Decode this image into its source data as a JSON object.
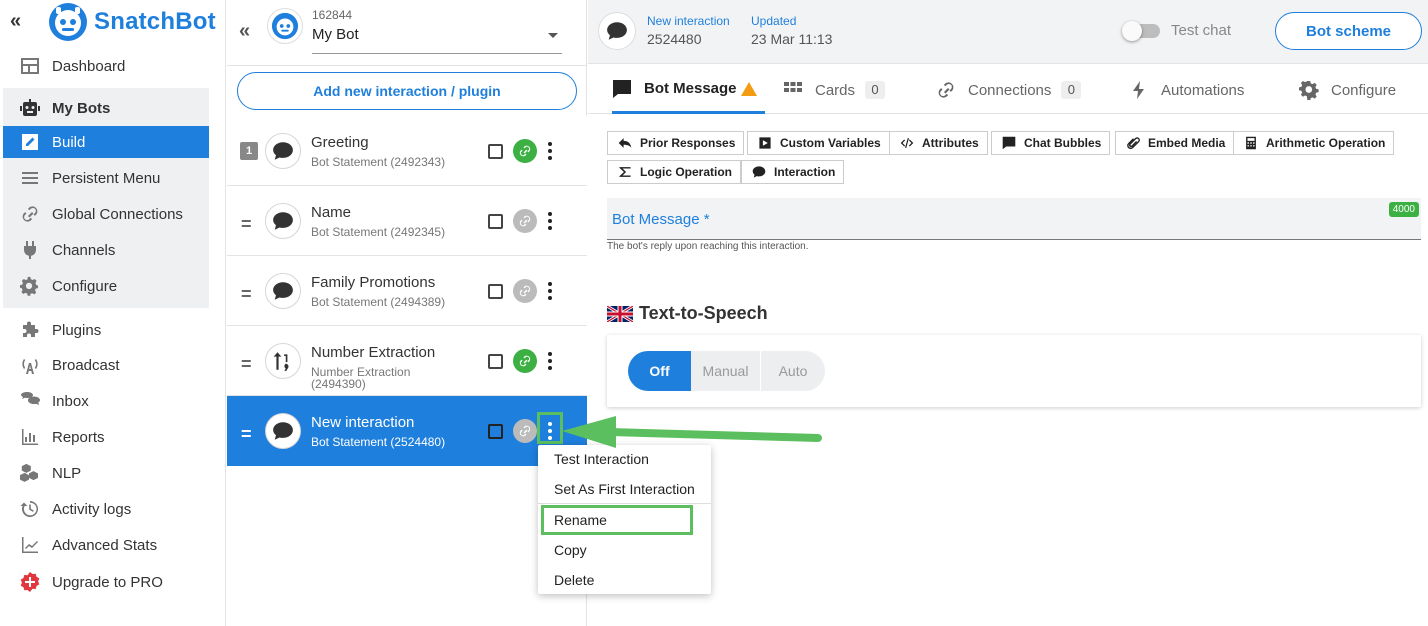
{
  "app": {
    "name": "SnatchBot",
    "brand_color": "#1e7fdc"
  },
  "sidebar": {
    "items": [
      {
        "label": "Dashboard",
        "icon": "dashboard-icon"
      },
      {
        "label": "My Bots",
        "icon": "robot-icon"
      },
      {
        "label": "Build",
        "icon": "edit-icon",
        "active": true
      },
      {
        "label": "Persistent Menu",
        "icon": "menu-icon"
      },
      {
        "label": "Global Connections",
        "icon": "link-icon"
      },
      {
        "label": "Channels",
        "icon": "plug-icon"
      },
      {
        "label": "Configure",
        "icon": "gear-icon"
      },
      {
        "label": "Plugins",
        "icon": "puzzle-icon"
      },
      {
        "label": "Broadcast",
        "icon": "broadcast-icon"
      },
      {
        "label": "Inbox",
        "icon": "chat-icon"
      },
      {
        "label": "Reports",
        "icon": "bar-chart-icon"
      },
      {
        "label": "NLP",
        "icon": "cubes-icon"
      },
      {
        "label": "Activity logs",
        "icon": "history-icon"
      },
      {
        "label": "Advanced Stats",
        "icon": "line-chart-icon"
      },
      {
        "label": "Upgrade to PRO",
        "icon": "plus-badge-icon"
      }
    ]
  },
  "bot": {
    "id": "162844",
    "name": "My Bot"
  },
  "interactions": {
    "add_label": "Add new interaction / plugin",
    "rows": [
      {
        "title": "Greeting",
        "subtitle": "Bot Statement (2492343)",
        "marker": "1",
        "link": "green"
      },
      {
        "title": "Name",
        "subtitle": "Bot Statement (2492345)",
        "marker": "=",
        "link": "grey"
      },
      {
        "title": "Family Promotions",
        "subtitle": "Bot Statement (2494389)",
        "marker": "=",
        "link": "grey"
      },
      {
        "title": "Number Extraction",
        "subtitle": "Number Extraction (2494390)",
        "marker": "=",
        "link": "green"
      },
      {
        "title": "New interaction",
        "subtitle": "Bot Statement (2524480)",
        "marker": "=",
        "link": "grey",
        "selected": true
      }
    ]
  },
  "context_menu": {
    "items": [
      "Test Interaction",
      "Set As First Interaction",
      "Rename",
      "Copy",
      "Delete"
    ],
    "highlight_color": "#5cbf5f"
  },
  "main": {
    "header": {
      "label1": "New interaction",
      "value1": "2524480",
      "label2": "Updated",
      "value2": "23 Mar 11:13",
      "test_chat": "Test chat",
      "scheme_btn": "Bot scheme"
    },
    "tabs": [
      {
        "label": "Bot Message",
        "icon": "message-icon",
        "active": true,
        "warning": true
      },
      {
        "label": "Cards",
        "icon": "grid-icon",
        "count": "0"
      },
      {
        "label": "Connections",
        "icon": "link-icon",
        "count": "0"
      },
      {
        "label": "Automations",
        "icon": "bolt-icon"
      },
      {
        "label": "Configure",
        "icon": "gear-icon"
      }
    ],
    "chips": [
      {
        "label": "Prior Responses",
        "icon": "reply-icon"
      },
      {
        "label": "Custom Variables",
        "icon": "play-square-icon"
      },
      {
        "label": "Attributes",
        "icon": "code-icon"
      },
      {
        "label": "Chat Bubbles",
        "icon": "message-icon"
      },
      {
        "label": "Embed Media",
        "icon": "paperclip-icon"
      },
      {
        "label": "Arithmetic Operation",
        "icon": "calculator-icon"
      },
      {
        "label": "Logic Operation",
        "icon": "sigma-icon"
      },
      {
        "label": "Interaction",
        "icon": "chat-bubble-icon"
      }
    ],
    "bot_message": {
      "label": "Bot Message *",
      "counter": "4000",
      "help": "The bot's reply upon reaching this interaction."
    },
    "tts": {
      "title": "Text-to-Speech",
      "options": [
        "Off",
        "Manual",
        "Auto"
      ],
      "selected": "Off"
    }
  }
}
